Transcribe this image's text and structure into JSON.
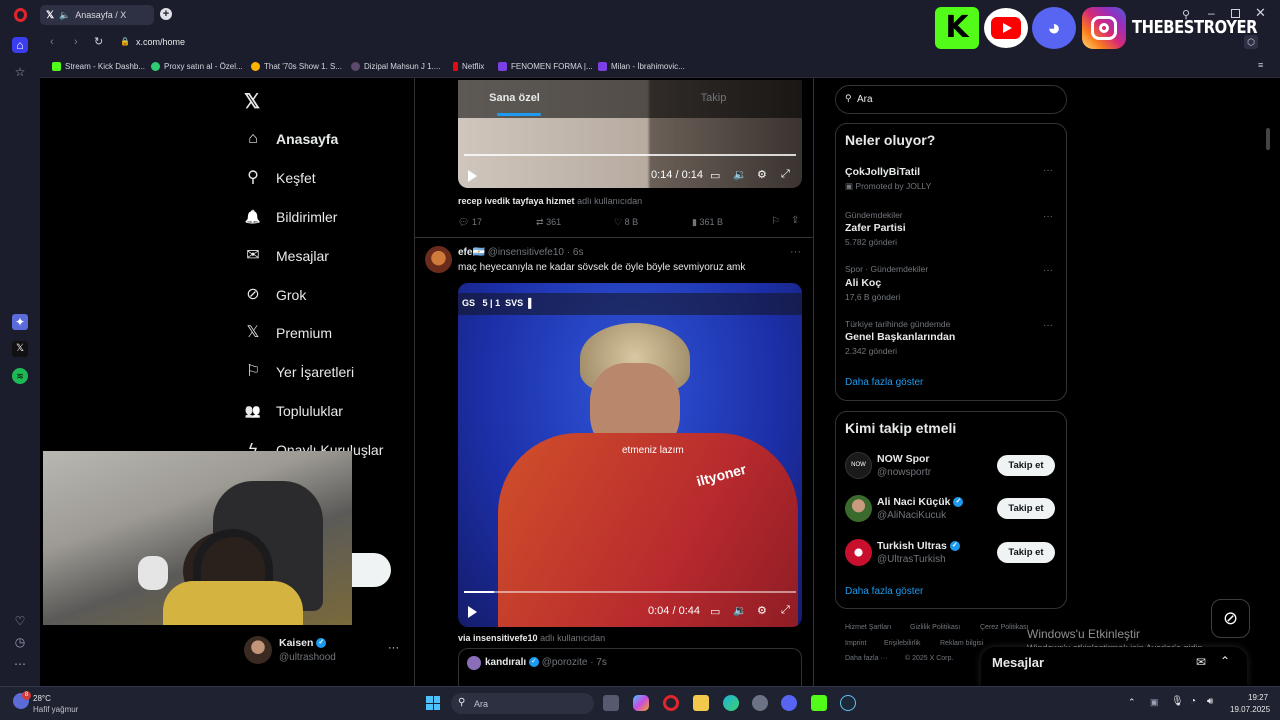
{
  "browser": {
    "tab_title": "Anasayfa / X",
    "url": "x.com/home",
    "bookmarks": [
      {
        "label": "Stream - Kick Dashb...",
        "color": "#53fc18"
      },
      {
        "label": "Proxy satın al - Özel...",
        "color": "#2ecc71"
      },
      {
        "label": "That '70s Show 1. S...",
        "color": "#ffb300"
      },
      {
        "label": "Dizipal Mahsun J 1....",
        "color": "#8e5cff"
      },
      {
        "label": "Netflix",
        "color": "#e50914"
      },
      {
        "label": "FENOMEN FORMA |...",
        "color": "#7b3fe4"
      },
      {
        "label": "Milan - İbrahimovic...",
        "color": "#7b3fe4"
      }
    ]
  },
  "overlay": {
    "brand_text": "THEBESTROYER",
    "webcam_desc": ""
  },
  "nav": {
    "items": [
      {
        "label": "Anasayfa",
        "icon": "home-icon",
        "glyph": "⌂"
      },
      {
        "label": "Keşfet",
        "icon": "search-icon",
        "glyph": "⚲"
      },
      {
        "label": "Bildirimler",
        "icon": "bell-icon",
        "glyph": "🔔"
      },
      {
        "label": "Mesajlar",
        "icon": "mail-icon",
        "glyph": "✉"
      },
      {
        "label": "Grok",
        "icon": "grok-icon",
        "glyph": "⊘"
      },
      {
        "label": "Premium",
        "icon": "x-premium-icon",
        "glyph": "𝕏"
      },
      {
        "label": "Yer İşaretleri",
        "icon": "bookmark-icon",
        "glyph": "⚐"
      },
      {
        "label": "Topluluklar",
        "icon": "communities-icon",
        "glyph": "👥"
      },
      {
        "label": "Onaylı Kuruluşlar",
        "icon": "lightning-icon",
        "glyph": "ϟ"
      }
    ],
    "post_button_fragment": "a",
    "profile": {
      "name": "Kaisen",
      "handle": "@ultrashood"
    }
  },
  "feed": {
    "tabs": [
      "Sana özel",
      "Takip"
    ],
    "tweet1": {
      "time": "0:14 / 0:14",
      "source_name": "recep ivedik tayfaya hizmet",
      "source_suffix": "adlı kullanıcıdan",
      "replies": "17",
      "retweets": "361",
      "likes": "8 B",
      "views": "361 B"
    },
    "tweet2": {
      "name": "efe🇦🇷",
      "handle_time": "@insensitivefe10 · 6s",
      "text": "maç heyecanıyla ne kadar sövsek de öyle böyle sevmiyoruz amk",
      "score_home": "GS",
      "score_h": "5",
      "score_a": "1",
      "score_away": "SVS",
      "caption": "etmeniz lazım",
      "jersey": "iltyoner",
      "time": "0:04 / 0:44",
      "source_name": "via insensitivefe10",
      "source_suffix": "adlı kullanıcıdan"
    },
    "quote": {
      "name": "kandıralı",
      "handle_time": "@porozite · 7s"
    }
  },
  "right": {
    "search_placeholder": "Ara",
    "trends_title": "Neler oluyor?",
    "trends": [
      {
        "top": "",
        "title": "ÇokJollyBiTatil",
        "sub": "Promoted by JOLLY"
      },
      {
        "top": "Gündemdekiler",
        "title": "Zafer Partisi",
        "sub": "5.782 gönderi"
      },
      {
        "top": "Spor · Gündemdekiler",
        "title": "Ali Koç",
        "sub": "17,6 B gönderi"
      },
      {
        "top": "Türkiye tarihinde gündemde",
        "title": "Genel Başkanlarından",
        "sub": "2.342 gönderi"
      }
    ],
    "show_more": "Daha fazla göster",
    "follow_title": "Kimi takip etmeli",
    "follow": [
      {
        "name": "NOW Spor",
        "handle": "@nowsportr",
        "btn": "Takip et"
      },
      {
        "name": "Ali Naci Küçük",
        "handle": "@AliNaciKucuk",
        "btn": "Takip et"
      },
      {
        "name": "Turkish Ultras",
        "handle": "@UltrasTurkish",
        "btn": "Takip et"
      }
    ],
    "show_more2": "Daha fazla göster",
    "footer": [
      "Hizmet Şartları",
      "Gizlilik Politikası",
      "Çerez Politikası",
      "Imprint",
      "Erişilebilirlik",
      "Reklam bilgisi",
      "Daha fazla ···",
      "© 2025 X Corp."
    ],
    "messages_label": "Mesajlar"
  },
  "windows": {
    "activate_title": "Windows'u Etkinleştir",
    "activate_sub": "Windows'u etkinleştirmek için Ayarlar'a gidin.",
    "weather_temp": "28°C",
    "weather_desc": "Hafif yağmur",
    "search_label": "Ara",
    "time": "19:27",
    "date": "19.07.2025",
    "weather_badge": "8"
  }
}
